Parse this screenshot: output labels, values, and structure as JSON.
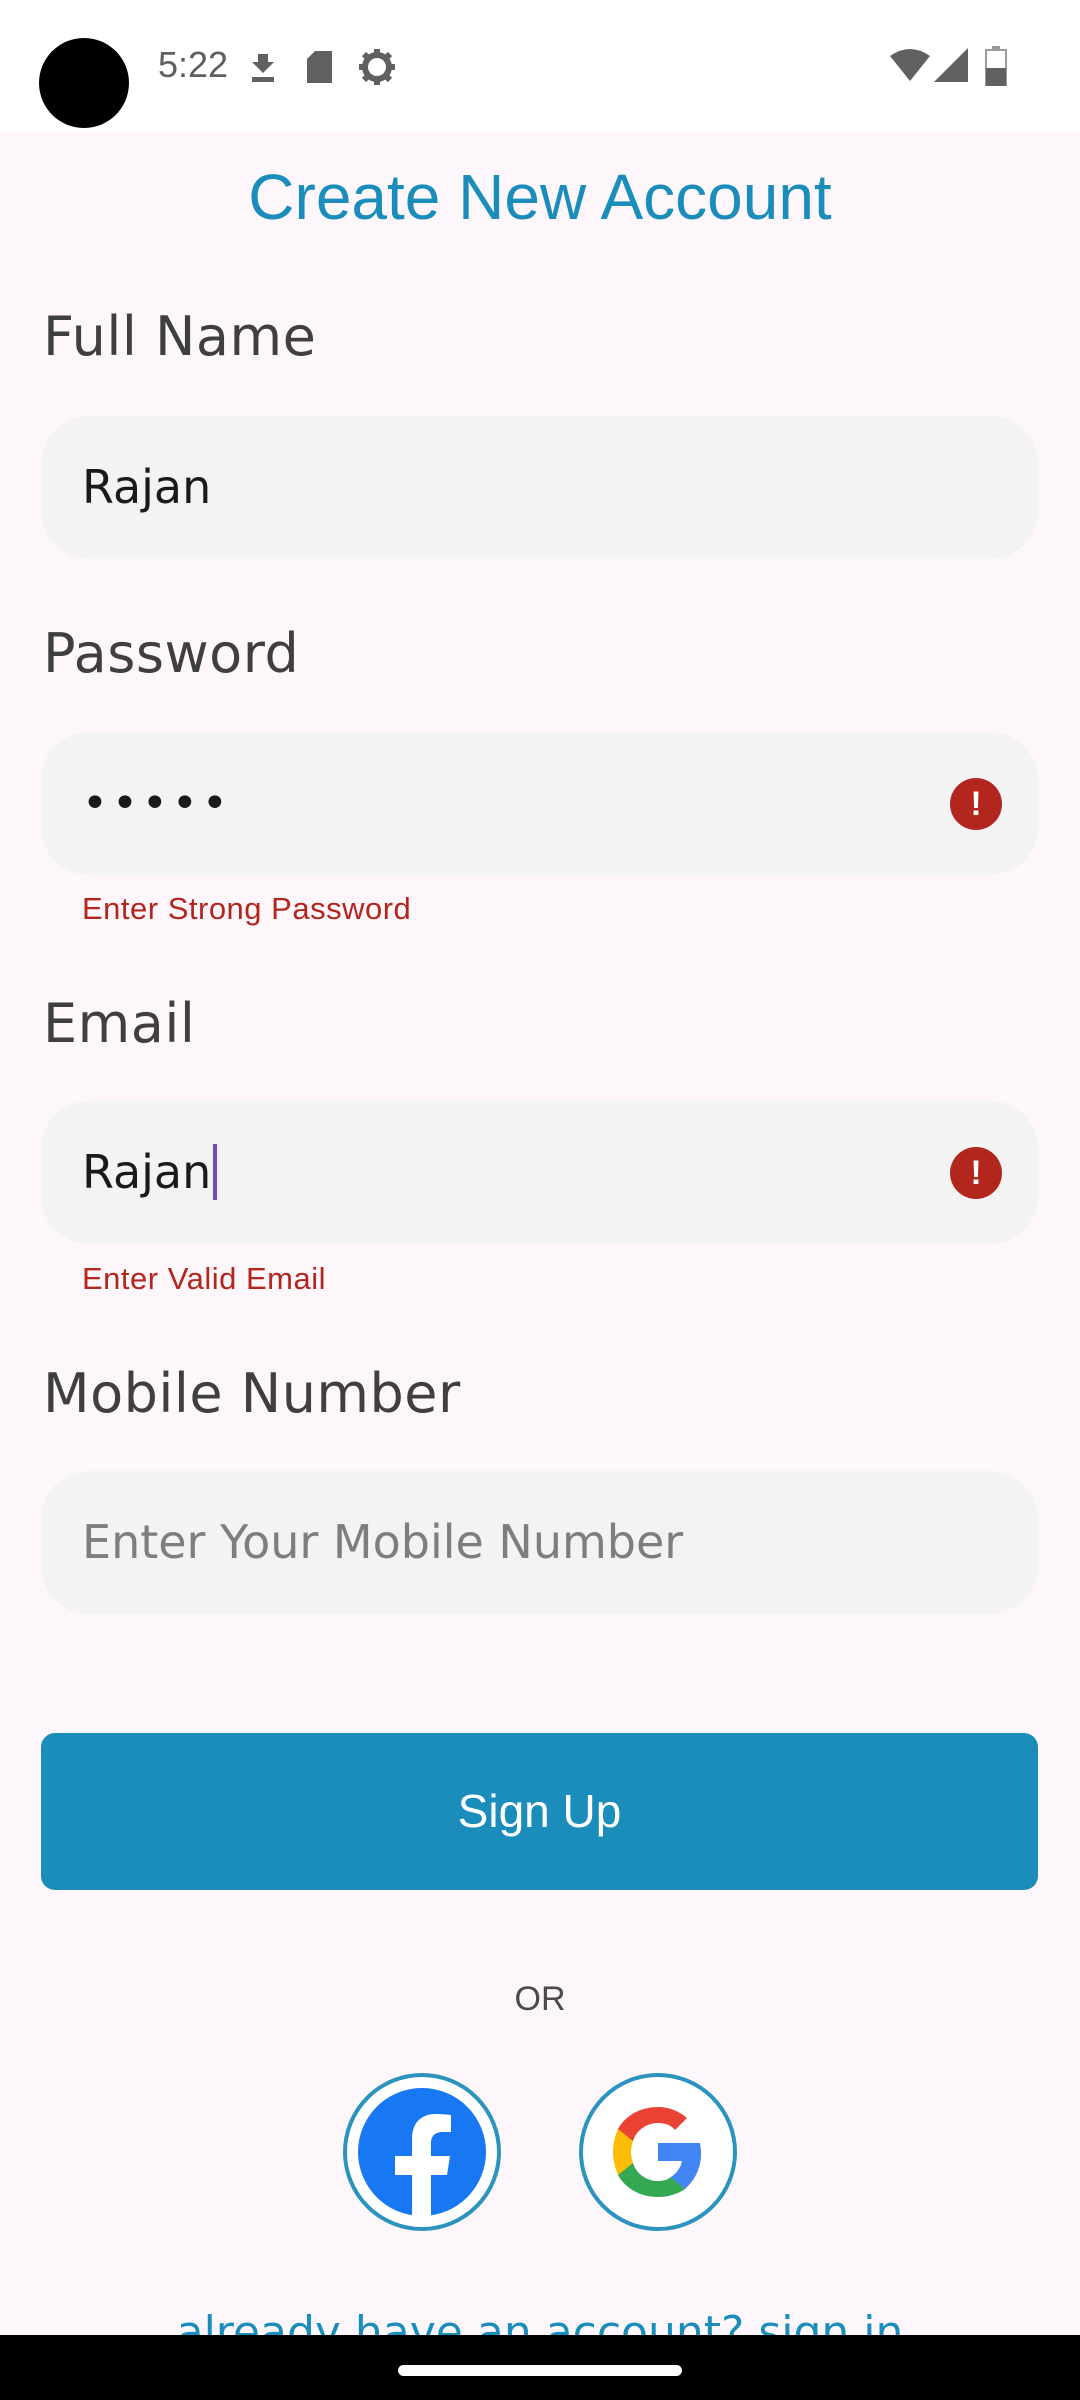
{
  "status_bar": {
    "time": "5:22",
    "left_icons": [
      "download-icon",
      "sd-card-icon",
      "settings-gear-icon"
    ],
    "right_icons": [
      "wifi-icon",
      "cellular-signal-icon",
      "battery-icon"
    ]
  },
  "page": {
    "title": "Create New Account"
  },
  "form": {
    "full_name": {
      "label": "Full Name",
      "value": "Rajan"
    },
    "password": {
      "label": "Password",
      "value": "•••••",
      "error": "Enter Strong Password"
    },
    "email": {
      "label": "Email",
      "value": "Rajan",
      "error": "Enter Valid Email"
    },
    "mobile": {
      "label": "Mobile Number",
      "placeholder": "Enter Your Mobile Number"
    }
  },
  "actions": {
    "signup_label": "Sign Up",
    "or_text": "OR",
    "social": [
      "facebook-icon",
      "google-icon"
    ],
    "signin_link": "already have an account? sign in"
  },
  "colors": {
    "accent": "#1b8dbb",
    "error": "#b3261e",
    "field_bg": "#f3f3f3",
    "page_bg": "#fdf7fb"
  }
}
